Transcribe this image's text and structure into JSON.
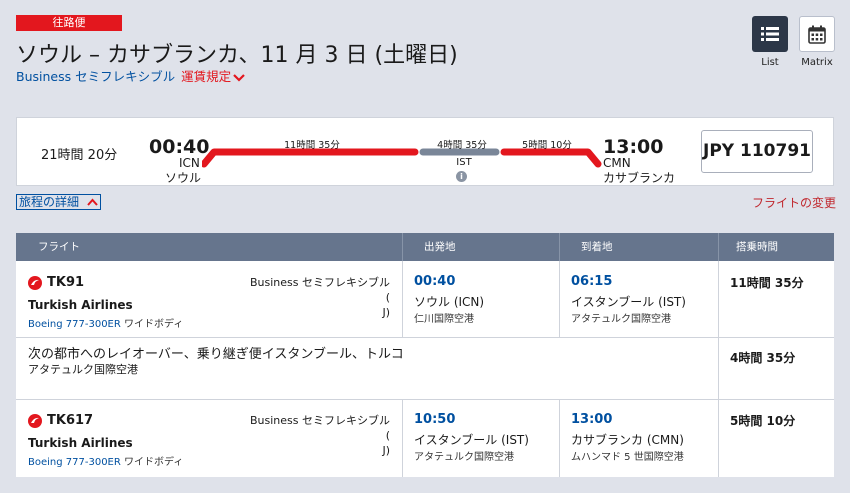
{
  "trip": {
    "badge": "往路便",
    "title": "ソウル – カサブランカ、11 月 3 日 (土曜日)",
    "cabin": "Business セミフレキシブル",
    "fare_rules": "運賃規定"
  },
  "view": {
    "list_label": "List",
    "matrix_label": "Matrix"
  },
  "summary": {
    "total_duration": "21時間 20分",
    "dep_time": "00:40",
    "dep_code": "ICN",
    "dep_city": "ソウル",
    "seg1_duration": "11時間 35分",
    "layover_duration": "4時間 35分",
    "layover_code": "IST",
    "seg2_duration": "5時間 10分",
    "arr_time": "13:00",
    "arr_code": "CMN",
    "arr_city": "カサブランカ",
    "price": "JPY 110791"
  },
  "links": {
    "details": "旅程の詳細",
    "change": "フライトの変更"
  },
  "table": {
    "headers": [
      "フライト",
      "出発地",
      "到着地",
      "搭乗時間"
    ],
    "segments": [
      {
        "flight_no": "TK91",
        "airline": "Turkish Airlines",
        "aircraft": "Boeing 777-300ER",
        "body": "ワイドボディ",
        "cabin": "Business セミフレキシブル (",
        "cabin_class": "J)",
        "dep_time": "00:40",
        "dep_city": "ソウル (ICN)",
        "dep_airport": "仁川国際空港",
        "arr_time": "06:15",
        "arr_city": "イスタンブール (IST)",
        "arr_airport": "アタテュルク国際空港",
        "duration": "11時間 35分"
      },
      {
        "flight_no": "TK617",
        "airline": "Turkish Airlines",
        "aircraft": "Boeing 777-300ER",
        "body": "ワイドボディ",
        "cabin": "Business セミフレキシブル (",
        "cabin_class": "J)",
        "dep_time": "10:50",
        "dep_city": "イスタンブール (IST)",
        "dep_airport": "アタテュルク国際空港",
        "arr_time": "13:00",
        "arr_city": "カサブランカ (CMN)",
        "arr_airport": "ムハンマド 5 世国際空港",
        "duration": "5時間 10分"
      }
    ],
    "layover": {
      "text": "次の都市へのレイオーバー、乗り継ぎ便イスタンブール、トルコ",
      "airport": "アタテュルク国際空港",
      "duration": "4時間 35分"
    }
  },
  "colors": {
    "accent_red": "#e3171e",
    "link_blue": "#0050a0",
    "header_slate": "#66758d",
    "layover_gray": "#7a8698"
  }
}
